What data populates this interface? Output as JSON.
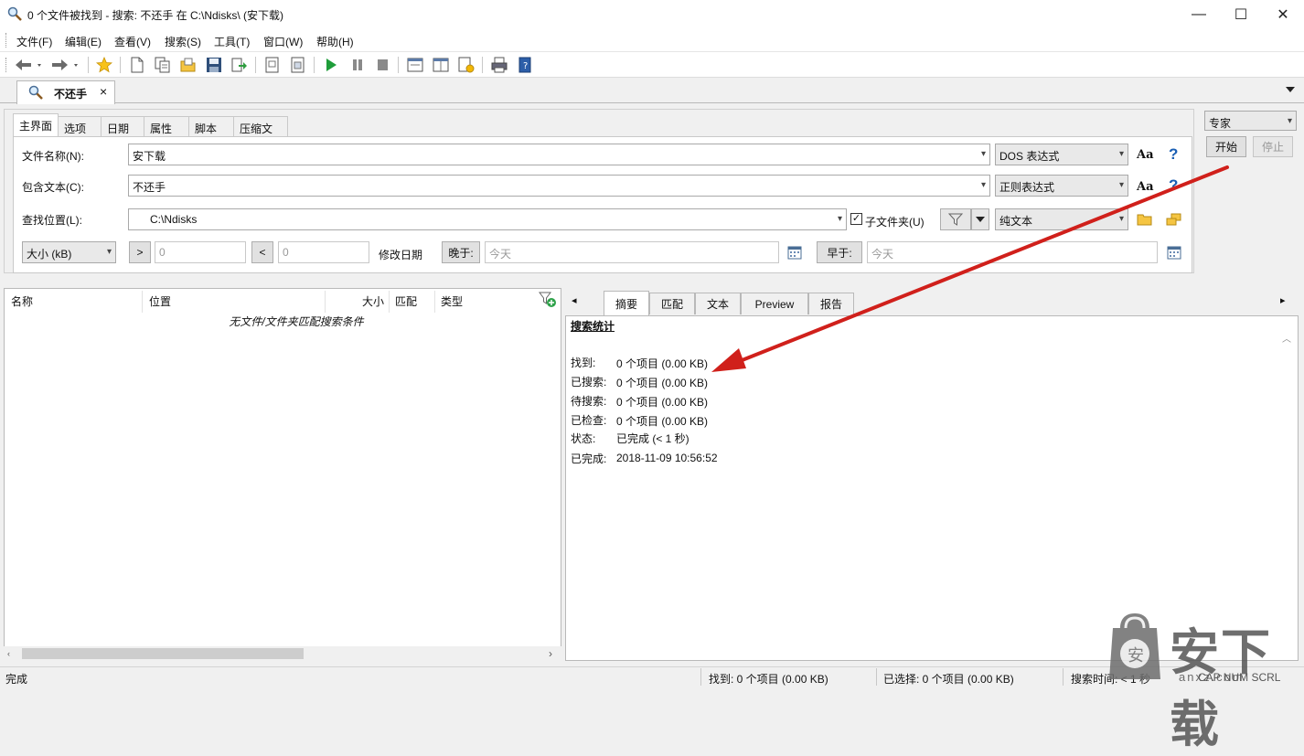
{
  "window": {
    "title": "0 个文件被找到 - 搜索: 不还手 在 C:\\Ndisks\\ (安下载)",
    "minimize": "—",
    "maximize": "☐",
    "close": "✕"
  },
  "menu": [
    "文件(F)",
    "编辑(E)",
    "查看(V)",
    "搜索(S)",
    "工具(T)",
    "窗口(W)",
    "帮助(H)"
  ],
  "doc_tab": {
    "label": "不还手",
    "close": "×"
  },
  "criteria_tabs": [
    "主界面",
    "选项",
    "日期",
    "属性",
    "脚本",
    "压缩文件"
  ],
  "criteria": {
    "filename_label": "文件名称(N):",
    "filename_value": "安下载",
    "filename_mode": "DOS 表达式",
    "content_label": "包含文本(C):",
    "content_value": "不还手",
    "content_mode": "正则表达式",
    "location_label": "查找位置(L):",
    "location_value": "C:\\Ndisks",
    "subfolders_label": "子文件夹(U)",
    "text_mode": "纯文本",
    "size_unit": "大小 (kB)",
    "gt": ">",
    "gt_value": "0",
    "lt": "<",
    "lt_value": "0",
    "modified_label": "修改日期",
    "after_label": "晚于:",
    "after_value": "今天",
    "before_label": "早于:",
    "before_value": "今天",
    "case_glyph": "Aa",
    "help_glyph": "?"
  },
  "controls": {
    "mode": "专家",
    "start": "开始",
    "stop": "停止"
  },
  "list": {
    "columns": [
      "名称",
      "位置",
      "大小",
      "匹配",
      "类型"
    ],
    "empty_message": "无文件/文件夹匹配搜索条件"
  },
  "result_tabs": [
    "摘要",
    "匹配",
    "文本",
    "Preview",
    "报告"
  ],
  "summary": {
    "heading": "搜索统计",
    "rows": [
      {
        "key": "找到:",
        "value": "0 个项目  (0.00 KB)"
      },
      {
        "key": "已搜索:",
        "value": "0 个项目  (0.00 KB)"
      },
      {
        "key": "待搜索:",
        "value": "0 个项目  (0.00 KB)"
      },
      {
        "key": "已检查:",
        "value": "0 个项目  (0.00 KB)"
      },
      {
        "key": "状态:",
        "value": "已完成  (< 1 秒)"
      },
      {
        "key": "已完成:",
        "value": "2018-11-09 10:56:52"
      }
    ]
  },
  "status": {
    "left": "完成",
    "found": "找到: 0 个项目 (0.00 KB)",
    "selected": "已选择: 0 个项目 (0.00 KB)",
    "time": "搜索时间: < 1 秒",
    "keys": "CAP  NUM  SCRL"
  },
  "watermark": {
    "text": "安下载",
    "sub": "anxz.com"
  },
  "colors": {
    "arrow": "#d0201b",
    "link_blue": "#1a5fb4",
    "icon_yellow": "#f2b705",
    "icon_green": "#1f9d3a"
  }
}
